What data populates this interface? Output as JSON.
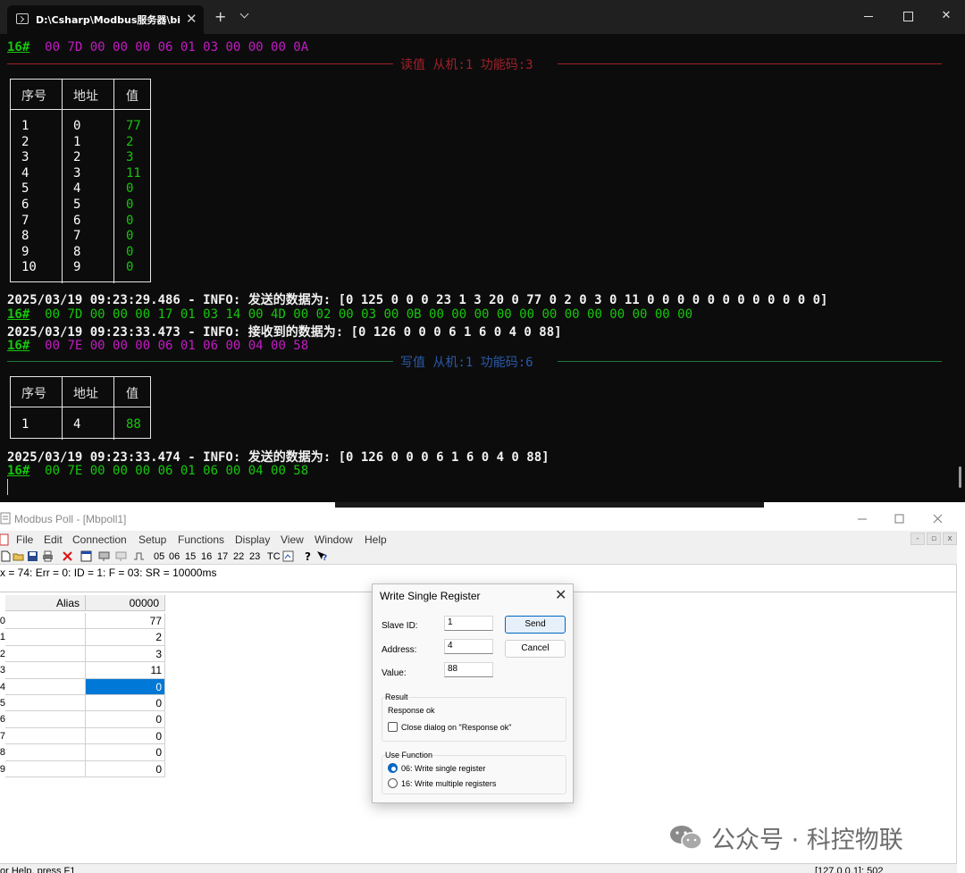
{
  "terminal": {
    "tab_title": "D:\\Csharp\\Modbus服务器\\bin\\",
    "close_glyph": "✕",
    "new_tab_glyph": "+",
    "win_close_glyph": "✕",
    "line1": {
      "tag": "16#",
      "hex": "00 7D 00 00 00 06 01 03 00 00 00 0A"
    },
    "sep_read": "读值 从机:1 功能码:3",
    "table1": {
      "headers": [
        "序号",
        "地址",
        "值"
      ],
      "col_no": "1\n2\n3\n4\n5\n6\n7\n8\n9\n10",
      "col_addr": "0\n1\n2\n3\n4\n5\n6\n7\n8\n9",
      "col_val": "77\n2\n3\n11\n0\n0\n0\n0\n0\n0"
    },
    "log1": "2025/03/19 09:23:29.486 - INFO: 发送的数据为: [0 125 0 0 0 23 1 3 20 0 77 0 2 0 3 0 11 0 0 0 0 0 0 0 0 0 0 0 0]",
    "line2": {
      "tag": "16#",
      "hex": "00 7D 00 00 00 17 01 03 14 00 4D 00 02 00 03 00 0B 00 00 00 00 00 00 00 00 00 00 00 00"
    },
    "log2": "2025/03/19 09:23:33.473 - INFO: 接收到的数据为: [0 126 0 0 0 6 1 6 0 4 0 88]",
    "line3": {
      "tag": "16#",
      "hex": "00 7E 00 00 00 06 01 06 00 04 00 58"
    },
    "sep_write": "写值 从机:1 功能码:6",
    "table2": {
      "headers": [
        "序号",
        "地址",
        "值"
      ],
      "col_no": "1",
      "col_addr": "4",
      "col_val": "88"
    },
    "log3": "2025/03/19 09:23:33.474 - INFO: 发送的数据为: [0 126 0 0 0 6 1 6 0 4 0 88]",
    "line4": {
      "tag": "16#",
      "hex": "00 7E 00 00 00 06 01 06 00 04 00 58"
    },
    "colors": {
      "background": "#0c0c0c",
      "green": "#16c60c",
      "magenta": "#c21cc2",
      "read_sep": "#a0202a",
      "write_sep": "#2a5aa8"
    }
  },
  "poll": {
    "title": "Modbus Poll - [Mbpoll1]",
    "menu": [
      "File",
      "Edit",
      "Connection",
      "Setup",
      "Functions",
      "Display",
      "View",
      "Window",
      "Help"
    ],
    "toolbar_codes": [
      "05",
      "06",
      "15",
      "16",
      "17",
      "22",
      "23",
      "TC"
    ],
    "status": "x = 74: Err = 0: ID = 1: F = 03: SR = 10000ms",
    "grid": {
      "alias_header": "Alias",
      "value_header": "00000",
      "row_numbers": [
        "0",
        "1",
        "2",
        "3",
        "4",
        "5",
        "6",
        "7",
        "8",
        "9"
      ],
      "values": [
        "77",
        "2",
        "3",
        "11",
        "0",
        "0",
        "0",
        "0",
        "0",
        "0"
      ],
      "selected_index": 4
    },
    "statusbar_left": "or Help, press F1",
    "statusbar_right": "[127.0.0.1]: 502"
  },
  "dialog": {
    "title": "Write Single Register",
    "close_glyph": "✕",
    "slave_id_label": "Slave ID:",
    "slave_id": "1",
    "address_label": "Address:",
    "address": "4",
    "value_label": "Value:",
    "value": "88",
    "send_label": "Send",
    "cancel_label": "Cancel",
    "result_label": "Result",
    "result_text": "Response ok",
    "close_on_ok_label": "Close dialog on \"Response ok\"",
    "use_function_label": "Use Function",
    "option_06": "06: Write single register",
    "option_16": "16: Write multiple registers"
  },
  "watermark": {
    "text": "公众号 · 科控物联",
    "icon": "wechat-icon"
  }
}
